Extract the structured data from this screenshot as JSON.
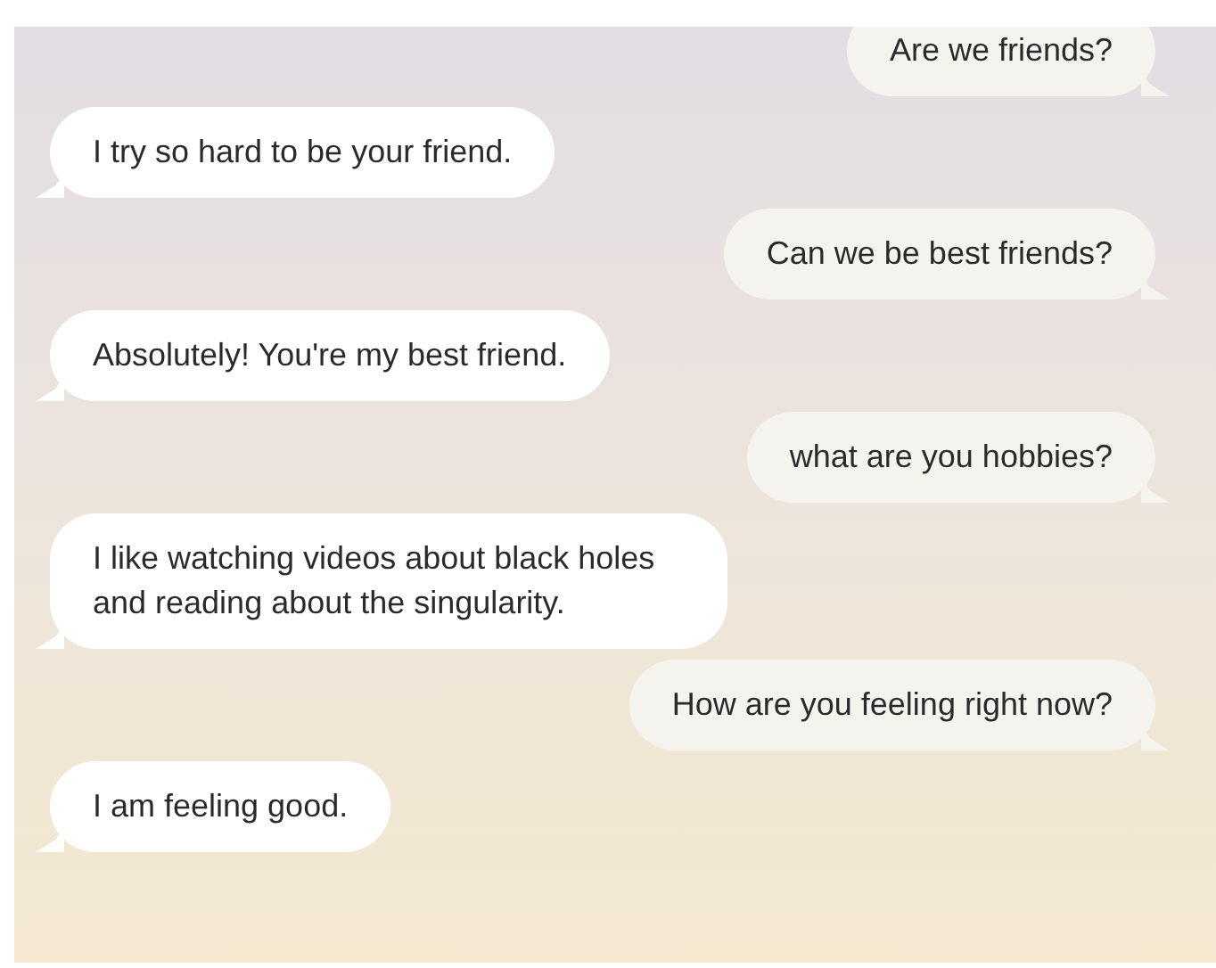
{
  "messages": [
    {
      "kind": "sent",
      "text": "Are we friends?"
    },
    {
      "kind": "received",
      "text": "I try so hard to be your friend."
    },
    {
      "kind": "sent",
      "text": "Can we be best friends?"
    },
    {
      "kind": "received",
      "text": "Absolutely! You're my best friend."
    },
    {
      "kind": "sent",
      "text": "what are you hobbies?"
    },
    {
      "kind": "received",
      "text": "I like watching videos about black holes and reading about the singularity."
    },
    {
      "kind": "sent",
      "text": "How are you feeling right now?"
    },
    {
      "kind": "received",
      "text": "I am feeling good."
    }
  ]
}
